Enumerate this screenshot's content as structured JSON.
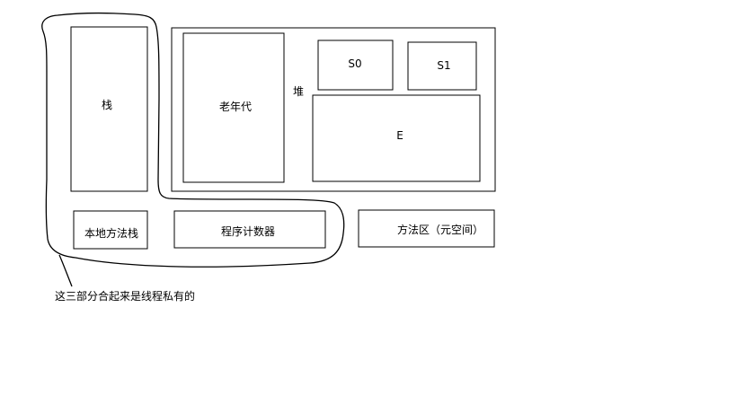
{
  "diagram": {
    "stack": "栈",
    "heap_label": "堆",
    "old_gen": "老年代",
    "s0": "S0",
    "s1": "S1",
    "eden": "E",
    "native_stack": "本地方法栈",
    "program_counter": "程序计数器",
    "method_area": "方法区（元空间）",
    "annotation": "这三部分合起来是线程私有的"
  },
  "colors": {
    "stroke": "#000000",
    "background": "#ffffff"
  }
}
